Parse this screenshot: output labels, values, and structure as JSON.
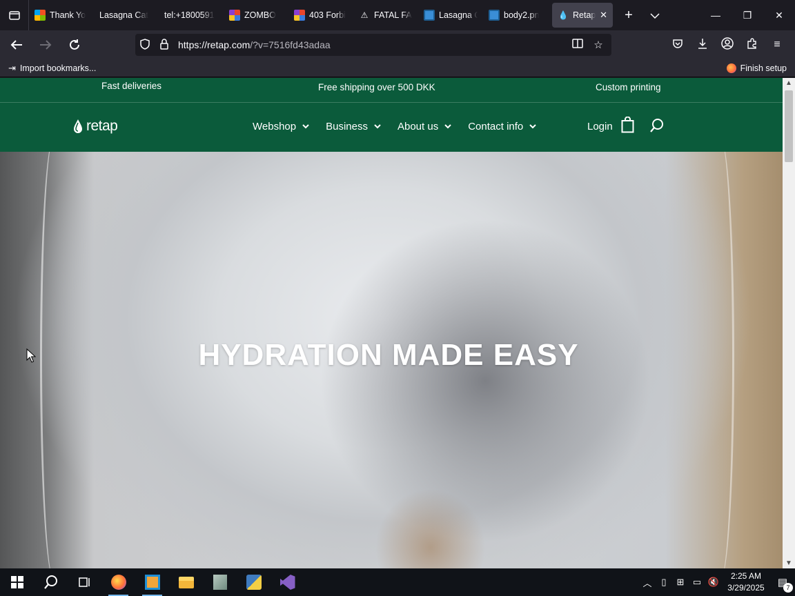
{
  "browser": {
    "tabs": [
      {
        "label": "Thank Yo",
        "favicon": "microsoft-icon"
      },
      {
        "label": "Lasagna Cat",
        "favicon": "none"
      },
      {
        "label": "tel:+1800591",
        "favicon": "none"
      },
      {
        "label": "ZOMBO",
        "favicon": "zombo-icon"
      },
      {
        "label": "403 Forbi",
        "favicon": "zombo-icon"
      },
      {
        "label": "FATAL FA",
        "favicon": "fatal-icon"
      },
      {
        "label": "Lasagna C",
        "favicon": "image-icon"
      },
      {
        "label": "body2.pn",
        "favicon": "image-icon"
      },
      {
        "label": "Retap",
        "favicon": "retap-icon",
        "active": true
      }
    ],
    "url": {
      "host": "https://retap.com",
      "path": "/?v=7516fd43adaa"
    },
    "bookmarks": {
      "import_label": "Import bookmarks...",
      "finish_setup_label": "Finish setup"
    }
  },
  "site": {
    "topbar": {
      "left": "Fast deliveries",
      "center": "Free shipping over 500 DKK",
      "right": "Custom printing"
    },
    "logo_text": "retap",
    "menu": [
      {
        "label": "Webshop"
      },
      {
        "label": "Business"
      },
      {
        "label": "About us"
      },
      {
        "label": "Contact info"
      }
    ],
    "login_label": "Login",
    "hero_title": "HYDRATION MADE EASY",
    "colors": {
      "brand_green": "#0b5b3b",
      "white": "#ffffff"
    }
  },
  "taskbar": {
    "apps": [
      "windows-start-icon",
      "search-icon",
      "task-view-icon",
      "firefox-icon",
      "app-icon",
      "file-explorer-icon",
      "notepad-icon",
      "python-idle-icon",
      "visual-studio-icon"
    ],
    "clock": {
      "time": "2:25 AM",
      "date": "3/29/2025"
    },
    "notifications_count": "7"
  }
}
